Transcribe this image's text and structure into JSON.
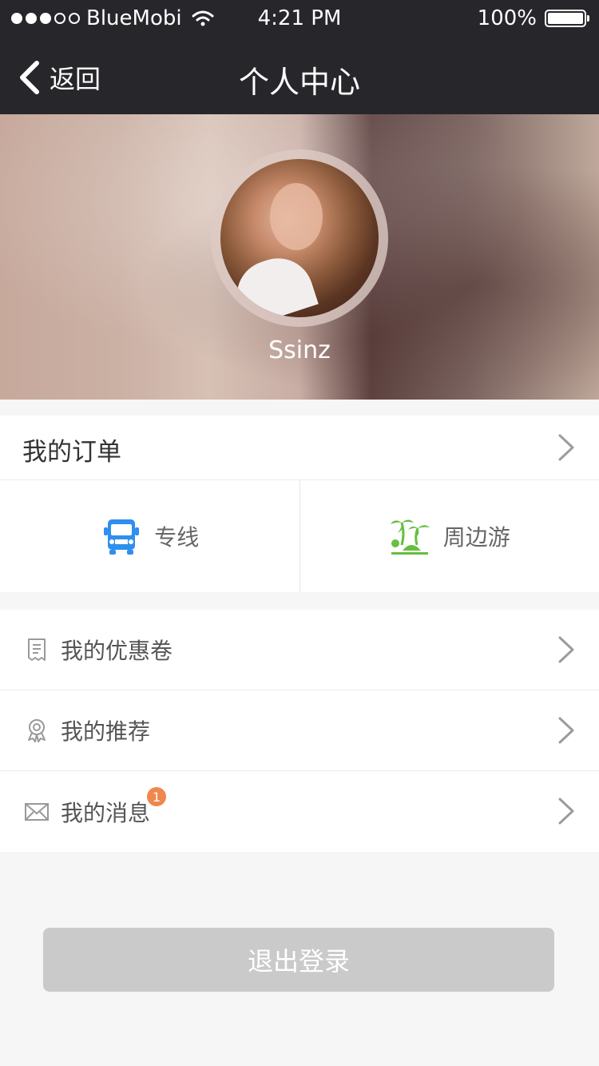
{
  "status_bar": {
    "carrier": "BlueMobi",
    "time": "4:21 PM",
    "battery": "100%",
    "battery_level": 1,
    "signal_dots_filled": 3,
    "signal_dots_total": 5
  },
  "nav": {
    "back_label": "返回",
    "title": "个人中心"
  },
  "profile": {
    "username": "Ssinz"
  },
  "orders": {
    "title": "我的订单",
    "categories": [
      {
        "icon": "bus-icon",
        "label": "专线",
        "color": "#2e8fee"
      },
      {
        "icon": "palm-tree-icon",
        "label": "周边游",
        "color": "#67bf3f"
      }
    ]
  },
  "menu": [
    {
      "icon": "receipt-icon",
      "label": "我的优惠卷",
      "badge": null
    },
    {
      "icon": "award-ribbon-icon",
      "label": "我的推荐",
      "badge": null
    },
    {
      "icon": "envelope-icon",
      "label": "我的消息",
      "badge": "1"
    }
  ],
  "logout_label": "退出登录",
  "colors": {
    "nav_background": "#27272b",
    "badge": "#f0874c",
    "logout_background": "#cacaca",
    "chevron": "#9c9c9c"
  }
}
